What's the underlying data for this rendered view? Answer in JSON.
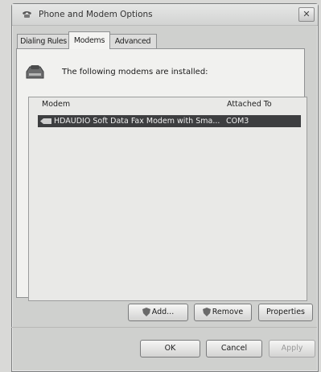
{
  "window": {
    "title": "Phone and Modem Options",
    "close_glyph": "✕"
  },
  "tabs": [
    {
      "label": "Dialing Rules",
      "active": false
    },
    {
      "label": "Modems",
      "active": true
    },
    {
      "label": "Advanced",
      "active": false
    }
  ],
  "modems_panel": {
    "heading": "The following modems are installed:",
    "columns": [
      "Modem",
      "Attached To"
    ],
    "rows": [
      {
        "modem": "HDAUDIO Soft Data Fax Modem with Sma...",
        "attached_to": "COM3",
        "selected": true
      }
    ]
  },
  "panel_buttons": {
    "add": "Add...",
    "remove": "Remove",
    "properties": "Properties"
  },
  "dialog_buttons": {
    "ok": "OK",
    "cancel": "Cancel",
    "apply": "Apply"
  },
  "icons": {
    "title": "phone-icon",
    "modem": "modem-icon",
    "row": "modem-row-icon",
    "shield": "shield-icon"
  },
  "colors": {
    "selection": "#3d3e40",
    "window_bg": "#cfd0ce"
  }
}
